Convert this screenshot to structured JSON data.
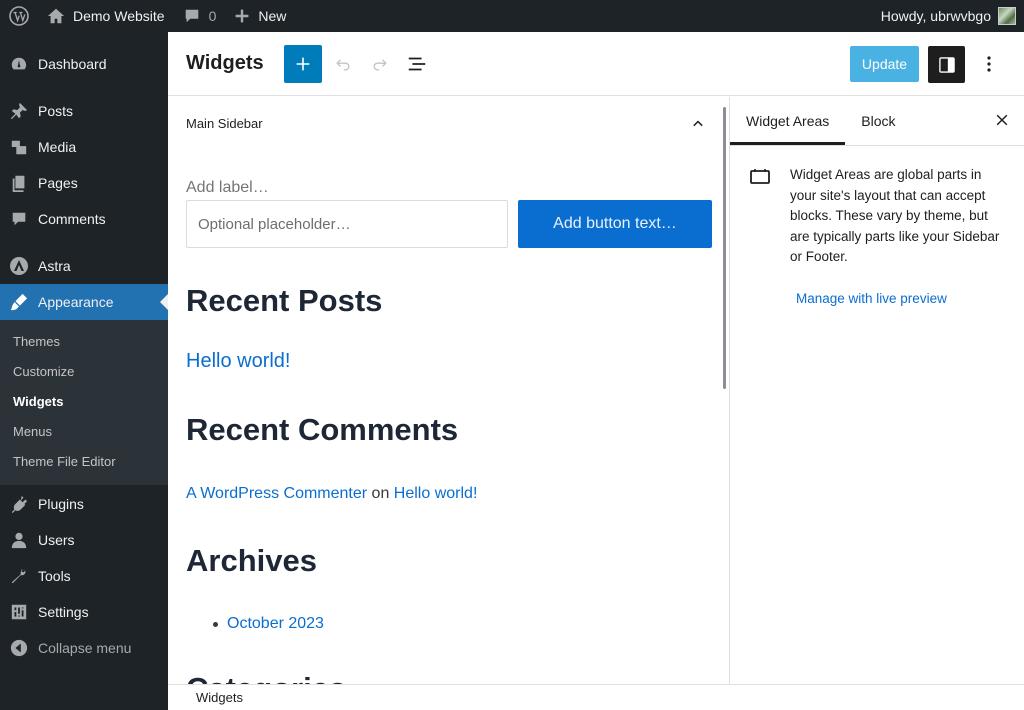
{
  "adminbar": {
    "site_name": "Demo Website",
    "comments_count": "0",
    "new_label": "New",
    "howdy": "Howdy, ubrwvbgo"
  },
  "sidebar": {
    "items": [
      {
        "label": "Dashboard",
        "icon": "dashboard-icon"
      },
      {
        "label": "Posts",
        "icon": "pin-icon"
      },
      {
        "label": "Media",
        "icon": "media-icon"
      },
      {
        "label": "Pages",
        "icon": "pages-icon"
      },
      {
        "label": "Comments",
        "icon": "comment-icon"
      },
      {
        "label": "Astra",
        "icon": "astra-icon"
      },
      {
        "label": "Appearance",
        "icon": "brush-icon"
      },
      {
        "label": "Plugins",
        "icon": "plug-icon"
      },
      {
        "label": "Users",
        "icon": "user-icon"
      },
      {
        "label": "Tools",
        "icon": "wrench-icon"
      },
      {
        "label": "Settings",
        "icon": "sliders-icon"
      },
      {
        "label": "Collapse menu",
        "icon": "collapse-icon"
      }
    ],
    "submenu": [
      "Themes",
      "Customize",
      "Widgets",
      "Menus",
      "Theme File Editor"
    ]
  },
  "header": {
    "title": "Widgets",
    "update_label": "Update"
  },
  "canvas": {
    "area_name": "Main Sidebar",
    "search_label": "Add label…",
    "search_placeholder": "Optional placeholder…",
    "search_button": "Add button text…",
    "recent_posts_heading": "Recent Posts",
    "post_link": "Hello world!",
    "recent_comments_heading": "Recent Comments",
    "commenter": "A WordPress Commenter",
    "comment_on": "on",
    "comment_post": "Hello world!",
    "archives_heading": "Archives",
    "archive_item": "October 2023",
    "categories_heading": "Categories"
  },
  "panel": {
    "tab_areas": "Widget Areas",
    "tab_block": "Block",
    "description": "Widget Areas are global parts in your site's layout that can accept blocks. These vary by theme, but are typically parts like your Sidebar or Footer.",
    "manage_link": "Manage with live preview"
  },
  "footer": {
    "breadcrumb": "Widgets"
  },
  "colors": {
    "admin_dark": "#1d2327",
    "accent": "#2271b1",
    "primary_button": "#007cba",
    "link": "#0a6ed1"
  }
}
